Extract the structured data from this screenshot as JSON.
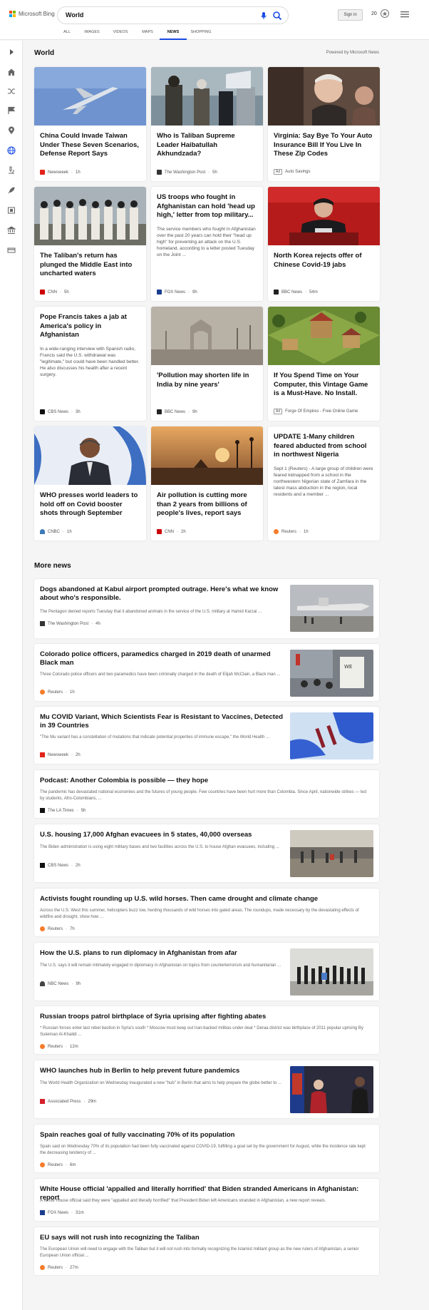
{
  "header": {
    "brand": "Microsoft Bing",
    "query": "World",
    "signin": "Sign in",
    "rewards_count": "20",
    "tabs": [
      "ALL",
      "IMAGES",
      "VIDEOS",
      "MAPS",
      "NEWS",
      "SHOPPING"
    ],
    "active_tab": "NEWS"
  },
  "section": {
    "title": "World",
    "powered_by": "Powered by Microsoft News"
  },
  "cards": [
    {
      "title": "China Could Invade Taiwan Under These Seven Scenarios, Defense Report Says",
      "source": "Newsweek",
      "time": "1h"
    },
    {
      "title": "Who is Taliban Supreme Leader Haibatullah Akhundzada?",
      "source": "The Washington Post",
      "time": "5h"
    },
    {
      "title": "Virginia: Say Bye To Your Auto Insurance Bill If You Live In These Zip Codes",
      "ad": "Ad",
      "source": "Auto Savings"
    },
    {
      "title": "The Taliban's return has plunged the Middle East into uncharted waters",
      "source": "CNN",
      "time": "5h"
    },
    {
      "title": "US troops who fought in Afghanistan can hold 'head up high,' letter from top military...",
      "desc": "The service members who fought in Afghanistan over the past 20 years can hold their \"head up high\" for preventing an attack on the U.S. homeland, according to a letter posted Tuesday on the Joint ...",
      "source": "FOX News",
      "time": "9h"
    },
    {
      "title": "North Korea rejects offer of Chinese Covid-19 jabs",
      "source": "BBC News",
      "time": "54m"
    },
    {
      "title": "Pope Francis takes a jab at America's policy in Afghanistan",
      "desc": "In a wide-ranging interview with Spanish radio, Francis said the U.S. withdrawal was \"legitimate,\" but could have been handled better. He also discusses his health after a recent surgery.",
      "source": "CBS News",
      "time": "3h"
    },
    {
      "title": "'Pollution may shorten life in India by nine years'",
      "source": "BBC News",
      "time": "9h"
    },
    {
      "title": "If You Spend Time on Your Computer, this Vintage Game is a Must-Have. No Install.",
      "ad": "Ad",
      "source": "Forge Of Empires - Free Online Game"
    },
    {
      "title": "WHO presses world leaders to hold off on Covid booster shots through September",
      "source": "CNBC",
      "time": "1h"
    },
    {
      "title": "Air pollution is cutting more than 2 years from billions of people's lives, report says",
      "source": "CNN",
      "time": "2h"
    },
    {
      "title": "UPDATE 1-Many children feared abducted from school in northwest Nigeria",
      "desc": "Sept 1 (Reuters) - A large group of children were feared kidnapped from a school in the northwestern Nigerian state of Zamfara in the latest mass abduction in the region, local residents and a member ...",
      "source": "Reuters",
      "time": "1h"
    }
  ],
  "more_news_title": "More news",
  "news": [
    {
      "title": "Dogs abandoned at Kabul airport prompted outrage. Here's what we know about who's responsible.",
      "desc": "The Pentagon denied reports Tuesday that it abandoned animals in the service of the U.S. military at Hamid Karzai ...",
      "source": "The Washington Post",
      "time": "4h"
    },
    {
      "title": "Colorado police officers, paramedics charged in 2019 death of unarmed Black man",
      "desc": "Three Colorado police officers and two paramedics have been criminally charged in the death of Elijah McClain, a Black man ...",
      "source": "Reuters",
      "time": "1h"
    },
    {
      "title": "Mu COVID Variant, Which Scientists Fear is Resistant to Vaccines, Detected in 39 Countries",
      "desc": "\"The Mu variant has a constellation of mutations that indicate potential properties of immune escape,\" the World Health ...",
      "source": "Newsweek",
      "time": "2h"
    },
    {
      "title": "Podcast: Another Colombia is possible — they hope",
      "desc": "The pandemic has devastated national economies and the futures of young people. Few countries have been hurt more than Colombia. Since April, nationwide strikes — led by students, Afro-Colombians, ...",
      "source": "The LA Times",
      "time": "5h"
    },
    {
      "title": "U.S. housing 17,000 Afghan evacuees in 5 states, 40,000 overseas",
      "desc": "The Biden administration is using eight military bases and two facilities across the U.S. to house Afghan evacuees, including ...",
      "source": "CBS News",
      "time": "2h"
    },
    {
      "title": "Activists fought rounding up U.S. wild horses. Then came drought and climate change",
      "desc": "Across the U.S. West this summer, helicopters buzz low, herding thousands of wild horses into gated areas. The roundups, made necessary by the devastating effects of wildfire and drought, show how ...",
      "source": "Reuters",
      "time": "7h"
    },
    {
      "title": "How the U.S. plans to run diplomacy in Afghanistan from afar",
      "desc": "The U.S. says it will remain intimately engaged in diplomacy in Afghanistan on topics from counterterrorism and humanitarian ...",
      "source": "NBC News",
      "time": "9h"
    },
    {
      "title": "Russian troops patrol birthplace of Syria uprising after fighting abates",
      "desc": "* Russian forces enter last rebel bastion in Syria's south * Moscow must keep out Iran-backed militias under deal * Deraa district was birthplace of 2011 popular uprising By Suleiman Al-Khalidi ...",
      "source": "Reuters",
      "time": "12m"
    },
    {
      "title": "WHO launches hub in Berlin to help prevent future pandemics",
      "desc": "The World Health Organization on Wednesday inaugurated a new \"hub\" in Berlin that aims to help prepare the globe better to ...",
      "source": "Associated Press",
      "time": "29m"
    },
    {
      "title": "Spain reaches goal of fully vaccinating 70% of its population",
      "desc": "Spain said on Wednesday 70% of its population had been fully vaccinated against COVID-19, fulfilling a goal set by the government for August, while the incidence rate kept the decreasing tendency of ...",
      "source": "Reuters",
      "time": "6m"
    },
    {
      "title": "White House official 'appalled and literally horrified' that Biden stranded Americans in Afghanistan: report",
      "desc": "A White House official said they were \"appalled and literally horrified\" that President Biden left Americans stranded in Afghanistan, a new report reveals.",
      "source": "FOX News",
      "time": "31m"
    },
    {
      "title": "EU says will not rush into recognizing the Taliban",
      "desc": "The European Union will need to engage with the Taliban but it will not rush into formally recognizing the Islamist militant group as the new rulers of Afghanistan, a senior European Union official ...",
      "source": "Reuters",
      "time": "27m"
    }
  ],
  "colors": {
    "accent": "#174ae4",
    "newsweek": "#e2231a",
    "cnn": "#cc0000",
    "reuters": "#f57c2b",
    "fox": "#1a3d8f",
    "bbc": "#222222",
    "cbs": "#111111",
    "cnbc": "#3d7ab8",
    "nbc": "#444444"
  }
}
